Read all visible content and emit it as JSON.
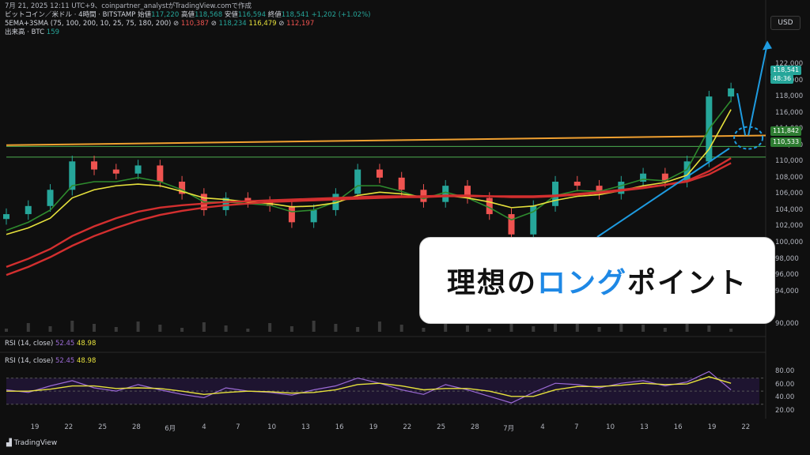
{
  "header": {
    "line1_prefix": "ビットコイン／米ドル · 4時間 · BITSTAMP",
    "open_label": "始値",
    "open": "117,220",
    "high_label": "高値",
    "high": "118,568",
    "low_label": "安値",
    "low": "116,594",
    "close_label": "終値",
    "close": "118,541",
    "change": "+1,202 (+1.02%)",
    "indicator_name": "5EMA+3SMA (75, 100, 200, 10, 25, 75, 180, 200)",
    "ind_v1": "110,387",
    "ind_v2": "118,234",
    "ind_v3": "116,479",
    "ind_v4": "112,197",
    "volume_label": "出来高 · BTC",
    "volume_value": "159"
  },
  "top_caption": "7月 21, 2025 12:11 UTC+9、coinpartner_analystがTradingView.comで作成",
  "currency_button": "USD",
  "price_badges": {
    "last_price": "118,541",
    "countdown": "48:36",
    "level_high": "111,842",
    "level_low": "110,533"
  },
  "callout": {
    "part1": "理想の",
    "part2": "ロング",
    "part3": "ポイント"
  },
  "rsi": {
    "label": "RSI (14, close)",
    "value1": "52.45",
    "value2": "48.98"
  },
  "footer": {
    "brand": "TradingView"
  },
  "colors": {
    "up": "#26a69a",
    "down": "#ef5350",
    "ema_yellow": "#e6e13c",
    "ema_green": "#2e8b2e",
    "sma_red": "#d32f2f",
    "trend_orange": "#f0a030",
    "level_green": "#4caf50",
    "annotation_blue": "#1e9be0",
    "rsi_purple": "#9c6bd6"
  },
  "chart_data": {
    "type": "line",
    "title": "",
    "xlabel": "",
    "ylabel": "",
    "ylim": [
      89000,
      126000
    ],
    "y_ticks": [
      90000,
      92000,
      94000,
      96000,
      98000,
      100000,
      102000,
      104000,
      106000,
      108000,
      110000,
      112000,
      114000,
      116000,
      118000,
      120000,
      122000
    ],
    "y_tick_labels": [
      "90,000",
      "",
      "94,000",
      "96,000",
      "98,000",
      "100,000",
      "102,000",
      "104,000",
      "106,000",
      "108,000",
      "110,000",
      "112,000",
      "114,000",
      "116,000",
      "118,000",
      "120,000",
      "122,000"
    ],
    "x_tick_labels": [
      "19",
      "22",
      "25",
      "28",
      "6月",
      "4",
      "7",
      "10",
      "13",
      "16",
      "19",
      "22",
      "25",
      "28",
      "7月",
      "4",
      "7",
      "10",
      "13",
      "16",
      "19",
      "22"
    ],
    "x": [
      0,
      2,
      4,
      6,
      8,
      10,
      12,
      14,
      16,
      18,
      20,
      22,
      24,
      26,
      28,
      30,
      32,
      34,
      36,
      38,
      40,
      42,
      44,
      46,
      48,
      50,
      52,
      54,
      56,
      58,
      60,
      62,
      64,
      66
    ],
    "series": [
      {
        "values": [
          103500,
          104500,
          106500,
          110000,
          109000,
          108500,
          109500,
          107500,
          106000,
          104000,
          105500,
          105000,
          104500,
          102500,
          104000,
          106000,
          109000,
          108000,
          106500,
          105000,
          107000,
          105500,
          103500,
          101000,
          104500,
          107500,
          107000,
          106000,
          107500,
          108500,
          107500,
          110000,
          118000,
          119000
        ]
      },
      {
        "values": [
          101500,
          102500,
          104000,
          107000,
          107500,
          107500,
          108000,
          107500,
          106500,
          105000,
          105000,
          104800,
          104600,
          103800,
          104000,
          105000,
          107000,
          107000,
          106300,
          105400,
          106200,
          105500,
          104300,
          102800,
          103800,
          105800,
          106400,
          106300,
          107000,
          107800,
          107600,
          109000,
          114000,
          117500
        ]
      },
      {
        "values": [
          101000,
          101800,
          103000,
          105500,
          106500,
          107000,
          107200,
          107000,
          106300,
          105500,
          105300,
          105000,
          104800,
          104400,
          104500,
          104900,
          105800,
          106200,
          106000,
          105600,
          105800,
          105500,
          105000,
          104300,
          104500,
          105200,
          105700,
          105900,
          106400,
          107000,
          107400,
          108300,
          111500,
          116400
        ]
      },
      {
        "values": [
          97000,
          98000,
          99200,
          100800,
          102000,
          103000,
          103800,
          104300,
          104600,
          104800,
          105000,
          105100,
          105200,
          105300,
          105400,
          105500,
          105600,
          105700,
          105700,
          105700,
          105800,
          105800,
          105700,
          105600,
          105600,
          105700,
          105900,
          106100,
          106400,
          106700,
          107100,
          107600,
          108800,
          110400
        ]
      },
      {
        "values": [
          96000,
          97000,
          98200,
          99600,
          100800,
          101800,
          102700,
          103400,
          103900,
          104300,
          104600,
          104800,
          105000,
          105100,
          105200,
          105300,
          105400,
          105500,
          105600,
          105600,
          105700,
          105700,
          105700,
          105700,
          105700,
          105800,
          106000,
          106200,
          106500,
          106800,
          107100,
          107500,
          108400,
          109800
        ]
      }
    ],
    "trendline": {
      "values": [
        112000,
        113200
      ]
    },
    "levels": [
      111842,
      110533
    ],
    "rsi_ylim": [
      20,
      90
    ],
    "rsi_ticks": [
      80,
      60,
      40,
      20
    ],
    "rsi_tick_labels": [
      "80.00",
      "60.00",
      "40.00",
      "20.00"
    ],
    "rsi_values": [
      52,
      48,
      58,
      66,
      55,
      50,
      60,
      52,
      45,
      40,
      55,
      50,
      48,
      44,
      52,
      58,
      70,
      62,
      52,
      45,
      60,
      52,
      42,
      32,
      48,
      62,
      60,
      55,
      62,
      66,
      58,
      64,
      80,
      52
    ],
    "rsi_ma_values": [
      50,
      50,
      53,
      58,
      58,
      54,
      55,
      54,
      50,
      45,
      48,
      50,
      49,
      47,
      48,
      52,
      60,
      62,
      58,
      52,
      54,
      54,
      50,
      42,
      42,
      52,
      57,
      57,
      59,
      62,
      60,
      61,
      72,
      62
    ]
  }
}
